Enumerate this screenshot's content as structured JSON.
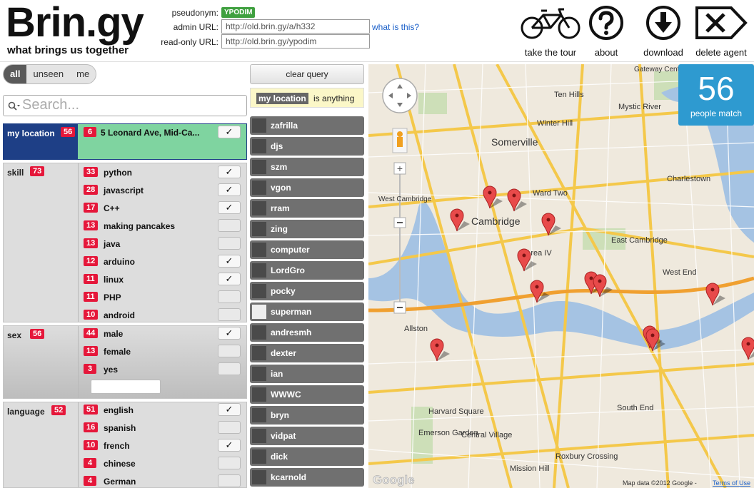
{
  "app": {
    "logo": "Brin.gy",
    "tagline": "what brings us together",
    "pseudonym_label": "pseudonym:",
    "pseudonym": "YPODIM",
    "admin_label": "admin URL:",
    "admin_url": "http://old.brin.gy/a/h332",
    "readonly_label": "read-only URL:",
    "readonly_url": "http://old.brin.gy/ypodim",
    "whatis": "what is this?"
  },
  "actions": [
    {
      "label": "take the tour",
      "icon": "bicycle-icon"
    },
    {
      "label": "about",
      "icon": "question-icon"
    },
    {
      "label": "download",
      "icon": "download-icon"
    },
    {
      "label": "delete agent",
      "icon": "delete-icon"
    }
  ],
  "filter_tabs": [
    "all",
    "unseen",
    "me"
  ],
  "active_tab": "all",
  "search": {
    "placeholder": "Search..."
  },
  "facets": {
    "location": {
      "name": "my location",
      "count": "56",
      "options": [
        {
          "count": "6",
          "label": "5 Leonard Ave, Mid-Ca...",
          "checked": true,
          "mark": "✓"
        }
      ]
    },
    "skill": {
      "name": "skill",
      "count": "73",
      "options": [
        {
          "count": "33",
          "label": "python",
          "checked": true,
          "mark": "✓"
        },
        {
          "count": "28",
          "label": "javascript",
          "checked": true,
          "mark": "✓"
        },
        {
          "count": "17",
          "label": "C++",
          "checked": true,
          "mark": "✓"
        },
        {
          "count": "13",
          "label": "making pancakes",
          "checked": false,
          "mark": ""
        },
        {
          "count": "13",
          "label": "java",
          "checked": false,
          "mark": ""
        },
        {
          "count": "12",
          "label": "arduino",
          "checked": true,
          "mark": "✓"
        },
        {
          "count": "11",
          "label": "linux",
          "checked": true,
          "mark": "✓"
        },
        {
          "count": "11",
          "label": "PHP",
          "checked": false,
          "mark": ""
        },
        {
          "count": "10",
          "label": "android",
          "checked": false,
          "mark": ""
        }
      ]
    },
    "sex": {
      "name": "sex",
      "count": "56",
      "options": [
        {
          "count": "44",
          "label": "male",
          "checked": true,
          "mark": "✓"
        },
        {
          "count": "13",
          "label": "female",
          "checked": false,
          "mark": ""
        },
        {
          "count": "3",
          "label": "yes",
          "checked": false,
          "mark": ""
        }
      ]
    },
    "language": {
      "name": "language",
      "count": "52",
      "options": [
        {
          "count": "51",
          "label": "english",
          "checked": true,
          "mark": "✓"
        },
        {
          "count": "16",
          "label": "spanish",
          "checked": false,
          "mark": ""
        },
        {
          "count": "10",
          "label": "french",
          "checked": true,
          "mark": "✓"
        },
        {
          "count": "4",
          "label": "chinese",
          "checked": false,
          "mark": ""
        },
        {
          "count": "4",
          "label": "German",
          "checked": false,
          "mark": ""
        }
      ]
    }
  },
  "query": {
    "clear_label": "clear query",
    "condition_tag": "my location",
    "condition_text": "is anything"
  },
  "people": [
    "zafrilla",
    "djs",
    "szm",
    "vgon",
    "rram",
    "zing",
    "computer",
    "LordGro",
    "pocky",
    "superman",
    "andresmh",
    "dexter",
    "ian",
    "WWWC",
    "bryn",
    "vidpat",
    "dick",
    "kcarnold"
  ],
  "people_with_photo": [
    "superman"
  ],
  "match": {
    "count": "56",
    "label": "people match"
  },
  "map": {
    "places": [
      {
        "label": "Somerville"
      },
      {
        "label": "Cambridge"
      },
      {
        "label": "East Cambridge"
      },
      {
        "label": "Allston"
      },
      {
        "label": "West End"
      },
      {
        "label": "Charlestown"
      },
      {
        "label": "Mystic River"
      },
      {
        "label": "Ward Two"
      },
      {
        "label": "Winter Hill"
      },
      {
        "label": "Ten Hills"
      },
      {
        "label": "South End"
      },
      {
        "label": "Roxbury Crossing"
      },
      {
        "label": "Central Village"
      },
      {
        "label": "Harvard Square"
      },
      {
        "label": "Emerson Garden"
      },
      {
        "label": "Mission Hill"
      },
      {
        "label": "Area IV"
      },
      {
        "label": "Gateway Center"
      },
      {
        "label": "West Cambridge"
      }
    ],
    "attribution": "Map data ©2012 Google -",
    "terms": "Terms of Use",
    "provider": "Google"
  }
}
